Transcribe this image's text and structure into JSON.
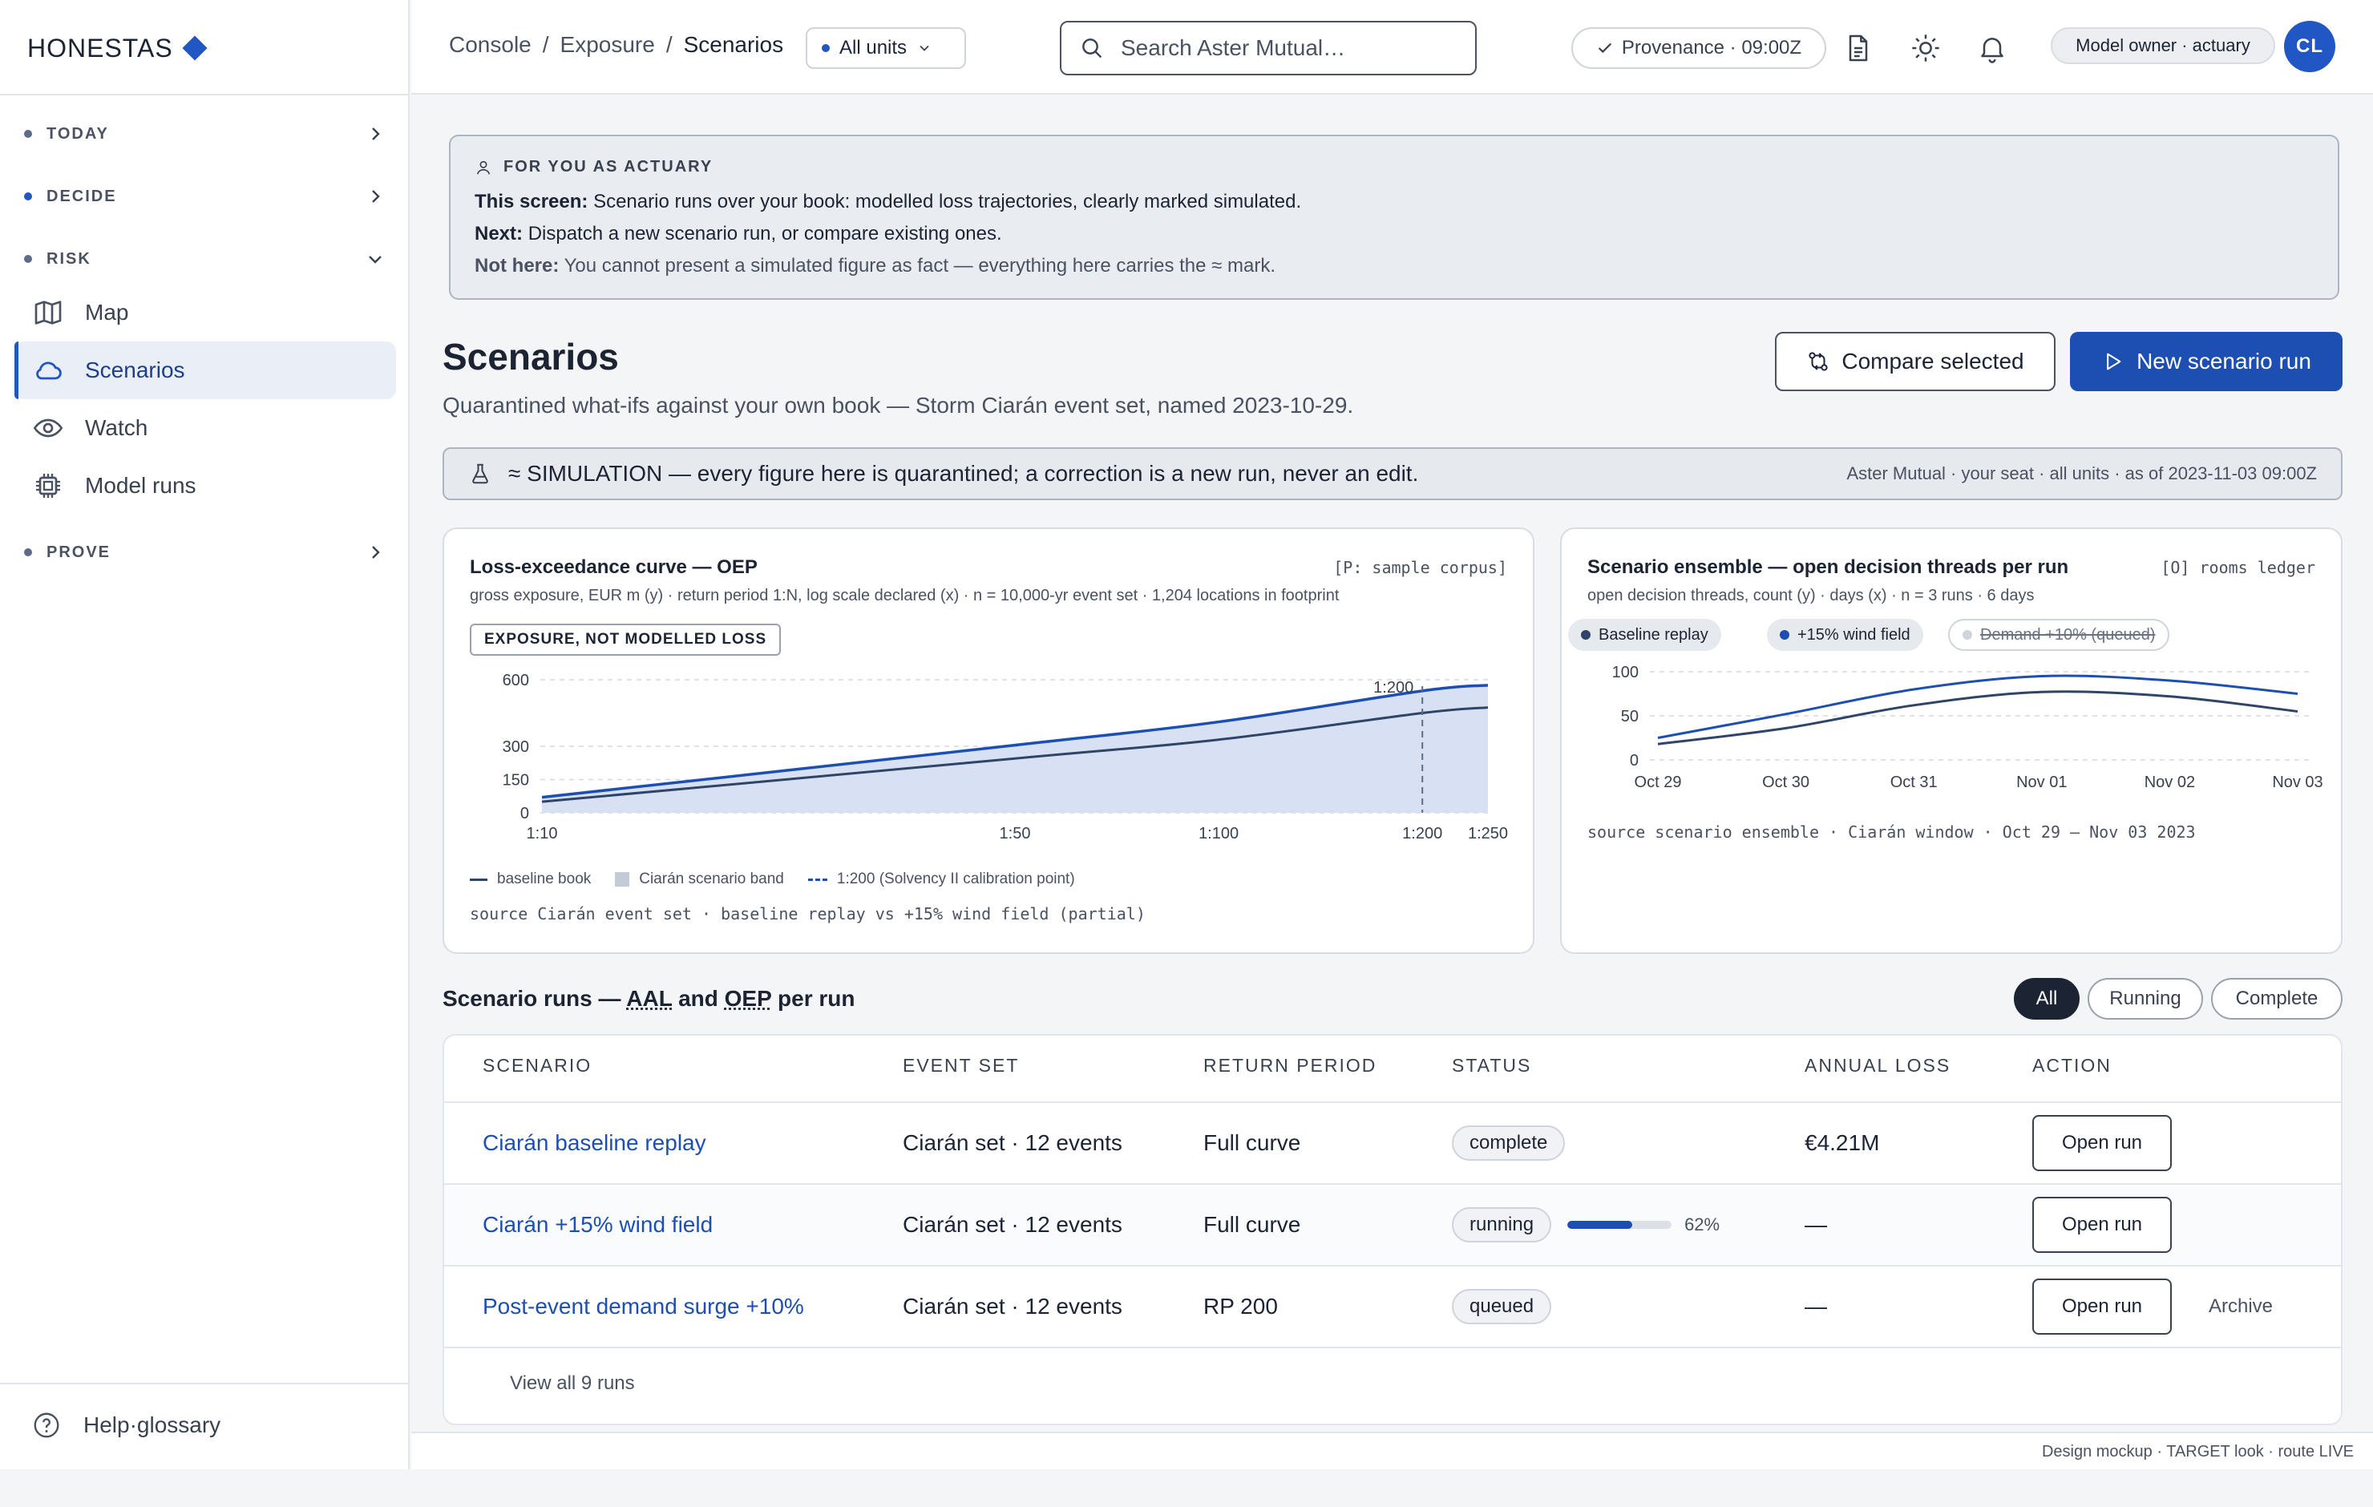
{
  "brand": {
    "name": "HONESTAS"
  },
  "sidebar": {
    "sections": [
      {
        "label": "TODAY"
      },
      {
        "label": "DECIDE"
      },
      {
        "label": "RISK"
      },
      {
        "label": "PROVE"
      }
    ],
    "items": [
      {
        "label": "Map",
        "icon": "map-icon"
      },
      {
        "label": "Scenarios",
        "icon": "cloud-icon",
        "active": true
      },
      {
        "label": "Watch",
        "icon": "eye-icon"
      },
      {
        "label": "Model runs",
        "icon": "chip-icon"
      }
    ],
    "help_label": "Help·glossary"
  },
  "topbar": {
    "breadcrumb": [
      "Console",
      "Exposure",
      "Scenarios"
    ],
    "units_label": "All units",
    "search_placeholder": "Search Aster Mutual…",
    "provenance_label": "Provenance · 09:00Z",
    "role_label": "Model owner · actuary",
    "avatar_initials": "CL"
  },
  "callout": {
    "caption": "FOR YOU AS ACTUARY",
    "line1_label": "This screen:",
    "line1_text": "Scenario runs over your book: modelled loss trajectories, clearly marked simulated.",
    "line2_label": "Next:",
    "line2_text": "Dispatch a new scenario run, or compare existing ones.",
    "line3_label": "Not here:",
    "line3_text": "You cannot present a simulated figure as fact — everything here carries the ≈ mark."
  },
  "page": {
    "title": "Scenarios",
    "subtitle": "Quarantined what-ifs against your own book — Storm Ciarán event set, named 2023-10-29.",
    "compare_label": "Compare selected",
    "new_run_label": "New scenario run"
  },
  "sim_banner": {
    "text": "≈ SIMULATION — every figure here is quarantined; a correction is a new run, never an edit.",
    "meta": "Aster Mutual · your seat · all units · as of 2023-11-03 09:00Z"
  },
  "oep_card": {
    "title": "Loss-exceedance curve — OEP",
    "tag": "[P: sample corpus]",
    "subtitle": "gross exposure, EUR m (y) · return period 1:N, log scale declared (x) · n = 10,000-yr event set · 1,204 locations in footprint",
    "badge": "EXPOSURE, NOT MODELLED LOSS",
    "legend": [
      "baseline book",
      "Ciarán scenario band",
      "1:200 (Solvency II calibration point)"
    ],
    "footer": "source Ciarán event set · baseline replay vs +15% wind field (partial)"
  },
  "ens_card": {
    "title": "Scenario ensemble — open decision threads per run",
    "tag": "[O] rooms ledger",
    "subtitle": "open decision threads, count (y) · days (x) · n = 3 runs · 6 days",
    "pills": [
      {
        "label": "Baseline replay",
        "color": "#2e4468"
      },
      {
        "label": "+15% wind field",
        "color": "#1d4fb3"
      },
      {
        "label": "Demand +10% (queued)",
        "color": "#cfd4dc"
      }
    ],
    "footer": "source scenario ensemble · Ciarán window · Oct 29 — Nov 03 2023"
  },
  "chart_data": [
    {
      "type": "area",
      "title": "Loss-exceedance curve — OEP",
      "x_categories": [
        "1:10",
        "1:50",
        "1:100",
        "1:200",
        "1:250"
      ],
      "ylim": [
        0,
        600
      ],
      "yticks": [
        0,
        150,
        300,
        600
      ],
      "marker": {
        "x": "1:200",
        "label": "1:200"
      },
      "series": [
        {
          "name": "baseline book",
          "values": [
            50,
            245,
            330,
            450,
            475
          ]
        },
        {
          "name": "Ciarán scenario band",
          "values": [
            70,
            305,
            410,
            550,
            575
          ]
        }
      ]
    },
    {
      "type": "line",
      "title": "Scenario ensemble — open decision threads per run",
      "x": [
        "Oct 29",
        "Oct 30",
        "Oct 31",
        "Nov 01",
        "Nov 02",
        "Nov 03"
      ],
      "ylim": [
        0,
        100
      ],
      "yticks": [
        0,
        50,
        100
      ],
      "series": [
        {
          "name": "Baseline replay",
          "values": [
            18,
            36,
            62,
            77,
            72,
            55
          ]
        },
        {
          "name": "+15% wind field",
          "values": [
            25,
            52,
            80,
            95,
            90,
            75
          ]
        }
      ]
    }
  ],
  "runs": {
    "title_prefix": "Scenario runs — ",
    "title_aal": "AAL",
    "title_and": " and ",
    "title_oep": "OEP",
    "title_suffix": " per run",
    "filters": [
      "All",
      "Running",
      "Complete"
    ],
    "columns": [
      "SCENARIO",
      "EVENT SET",
      "RETURN PERIOD",
      "STATUS",
      "ANNUAL LOSS",
      "ACTION"
    ],
    "rows": [
      {
        "scenario": "Ciarán baseline replay",
        "event_set": "Ciarán set · 12 events",
        "return_period": "Full curve",
        "status": "complete",
        "annual_loss": "€4.21M",
        "action": "Open run"
      },
      {
        "scenario": "Ciarán +15% wind field",
        "event_set": "Ciarán set · 12 events",
        "return_period": "Full curve",
        "status": "running",
        "progress": 0.62,
        "progress_label": "62%",
        "annual_loss": "—",
        "action": "Open run"
      },
      {
        "scenario": "Post-event demand surge +10%",
        "event_set": "Ciarán set · 12 events",
        "return_period": "RP 200",
        "status": "queued",
        "annual_loss": "—",
        "action": "Open run",
        "extra_action": "Archive"
      }
    ],
    "view_all": "View all 9 runs"
  },
  "footer": {
    "text": "Design mockup · TARGET look · route LIVE"
  }
}
